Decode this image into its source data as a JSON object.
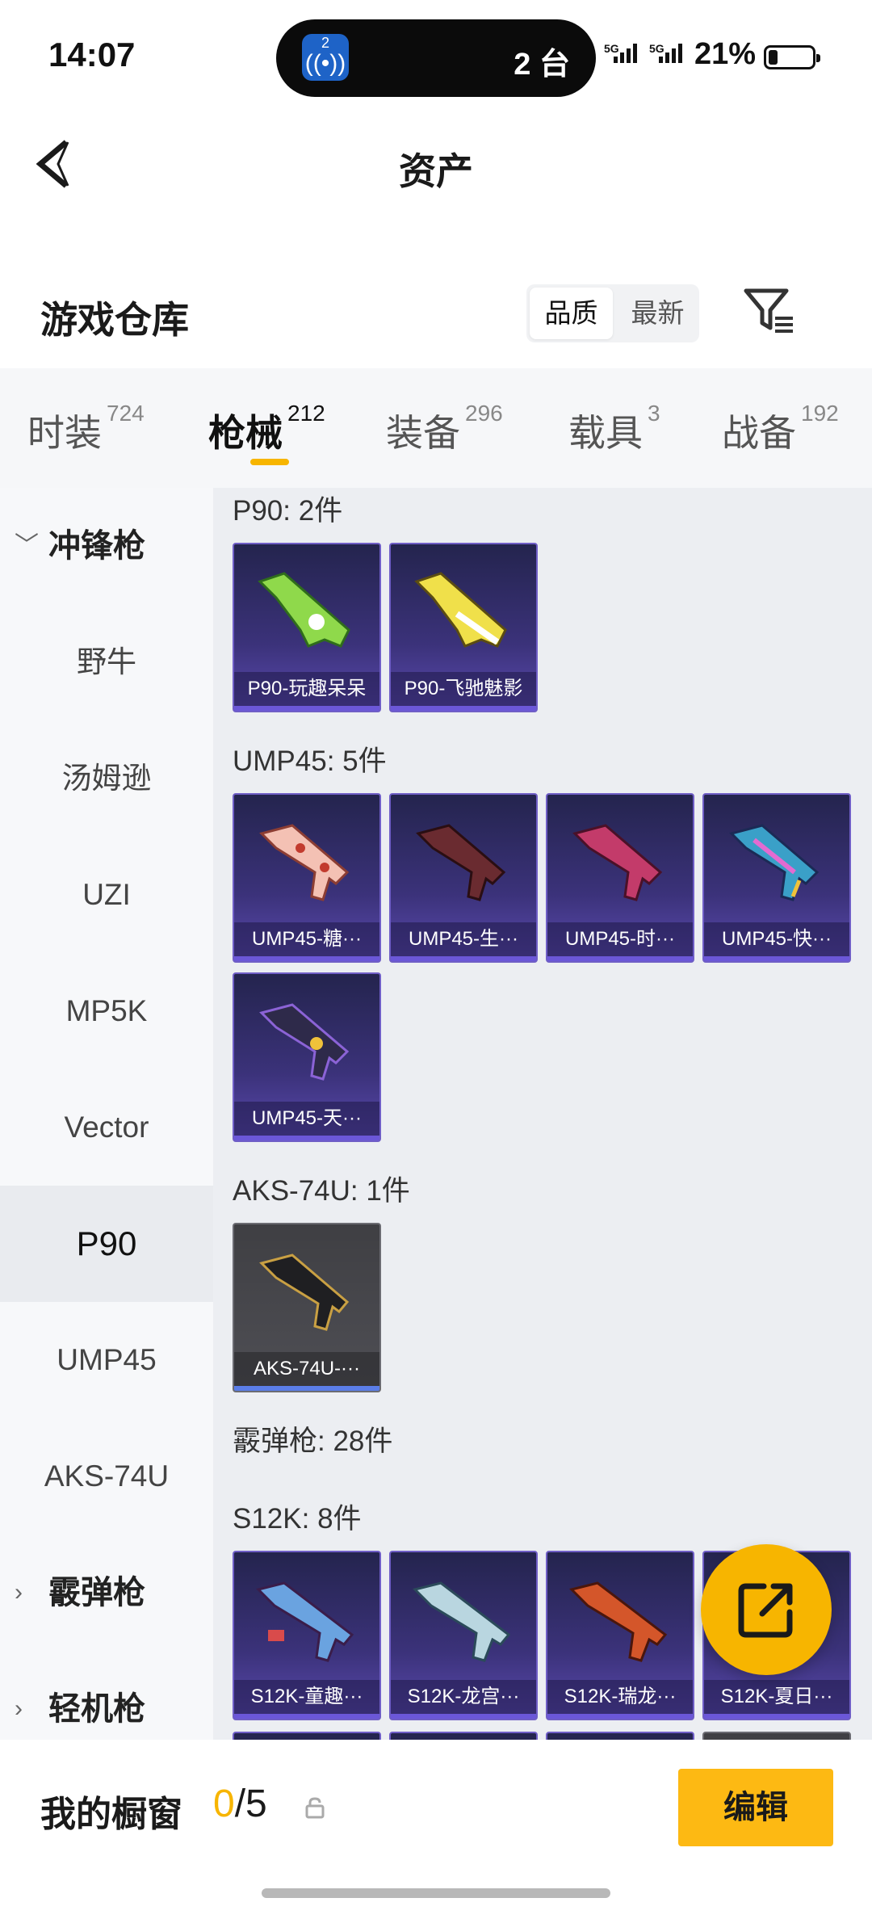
{
  "status": {
    "time": "14:07",
    "island_count": "2 台",
    "island_badge": "2",
    "net1": "5G",
    "net2": "5G",
    "battery": "21%",
    "battery_level": 0.21
  },
  "header": {
    "title": "资产"
  },
  "warehouse": {
    "title": "游戏仓库",
    "sort_options": [
      "品质",
      "最新"
    ],
    "sort_selected": "品质"
  },
  "tabs": [
    {
      "label": "时装",
      "count": "724"
    },
    {
      "label": "枪械",
      "count": "212"
    },
    {
      "label": "装备",
      "count": "296"
    },
    {
      "label": "载具",
      "count": "3"
    },
    {
      "label": "战备",
      "count": "192"
    }
  ],
  "active_tab": "枪械",
  "sidebar": {
    "items": [
      {
        "label": "冲锋枪",
        "type": "group",
        "expanded": true
      },
      {
        "label": "野牛",
        "type": "item"
      },
      {
        "label": "汤姆逊",
        "type": "item"
      },
      {
        "label": "UZI",
        "type": "item"
      },
      {
        "label": "MP5K",
        "type": "item"
      },
      {
        "label": "Vector",
        "type": "item"
      },
      {
        "label": "P90",
        "type": "item",
        "selected": true
      },
      {
        "label": "UMP45",
        "type": "item"
      },
      {
        "label": "AKS-74U",
        "type": "item"
      },
      {
        "label": "霰弹枪",
        "type": "group",
        "expanded": false
      },
      {
        "label": "轻机枪",
        "type": "group",
        "expanded": false
      }
    ]
  },
  "sections": {
    "p90": {
      "header": "P90: 2件",
      "items": [
        "P90-玩趣呆呆",
        "P90-飞驰魅影"
      ]
    },
    "ump45": {
      "header": "UMP45: 5件",
      "items": [
        "UMP45-糖···",
        "UMP45-生···",
        "UMP45-时···",
        "UMP45-快···",
        "UMP45-天···"
      ]
    },
    "aks": {
      "header": "AKS-74U: 1件",
      "items": [
        "AKS-74U-···"
      ]
    },
    "shotgun": {
      "header": "霰弹枪: 28件"
    },
    "s12k": {
      "header": "S12K: 8件",
      "items": [
        "S12K-童趣···",
        "S12K-龙宫···",
        "S12K-瑞龙···",
        "S12K-夏日···"
      ]
    }
  },
  "bottom": {
    "title": "我的橱窗",
    "count_current": "0",
    "count_sep": "/",
    "count_total": "5",
    "edit_label": "编辑"
  },
  "colors": {
    "accent": "#f7b500",
    "card_purple": "#3b327a",
    "card_gray": "#4f4f55"
  }
}
